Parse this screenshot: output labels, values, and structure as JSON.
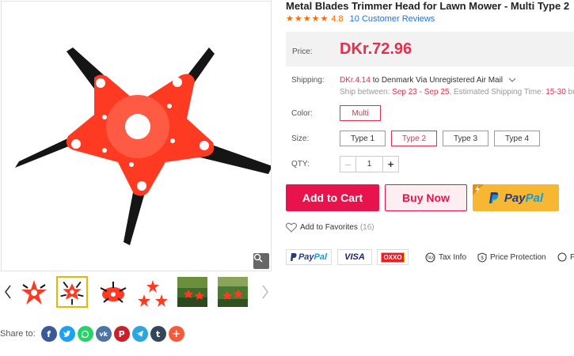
{
  "product": {
    "title": "Metal Blades Trimmer Head for Lawn Mower - Multi Type 2",
    "rating_value": "4.8",
    "rating_stars": 4.8,
    "reviews_label": "10 Customer Reviews"
  },
  "price": {
    "label": "Price:",
    "value": "DKr.72.96"
  },
  "shipping": {
    "label": "Shipping:",
    "price": "DKr.4.14",
    "method": "to Denmark Via Unregistered Air Mail",
    "ship_between_label": "Ship between:",
    "date_range": "Sep 23 - Sep 25",
    "estimated_label": ", Estimated Shipping Time:",
    "estimated_time": "15-30",
    "estimated_suffix": "bus"
  },
  "color": {
    "label": "Color:",
    "options": [
      "Multi"
    ],
    "selected": "Multi"
  },
  "size": {
    "label": "Size:",
    "options": [
      "Type 1",
      "Type 2",
      "Type 3",
      "Type 4"
    ],
    "selected": "Type 2"
  },
  "qty": {
    "label": "QTY:",
    "value": "1",
    "minus": "–",
    "plus": "+"
  },
  "actions": {
    "add_to_cart": "Add to Cart",
    "buy_now": "Buy Now",
    "paypal_pay": "Pay",
    "paypal_pal": "Pal"
  },
  "favorites": {
    "label": "Add to Favorites",
    "count": "(16)"
  },
  "payments": {
    "paypal_pay": "Pay",
    "paypal_pal": "Pal",
    "visa": "VISA",
    "oxxo": "OXXO"
  },
  "services": {
    "tax_info": "Tax Info",
    "price_protection": "Price Protection",
    "cut_off": "P"
  },
  "share": {
    "label": "Share to:",
    "networks": [
      "facebook",
      "twitter",
      "whatsapp",
      "vk",
      "pinterest",
      "telegram",
      "tumblr",
      "more"
    ]
  },
  "colors": {
    "accent": "#e62e4d",
    "button_red": "#e8134c",
    "paypal_yellow": "#f7b733",
    "star_orange": "#ff6a00",
    "link_blue": "#1a73e8",
    "blade_red": "#ff3a22"
  }
}
